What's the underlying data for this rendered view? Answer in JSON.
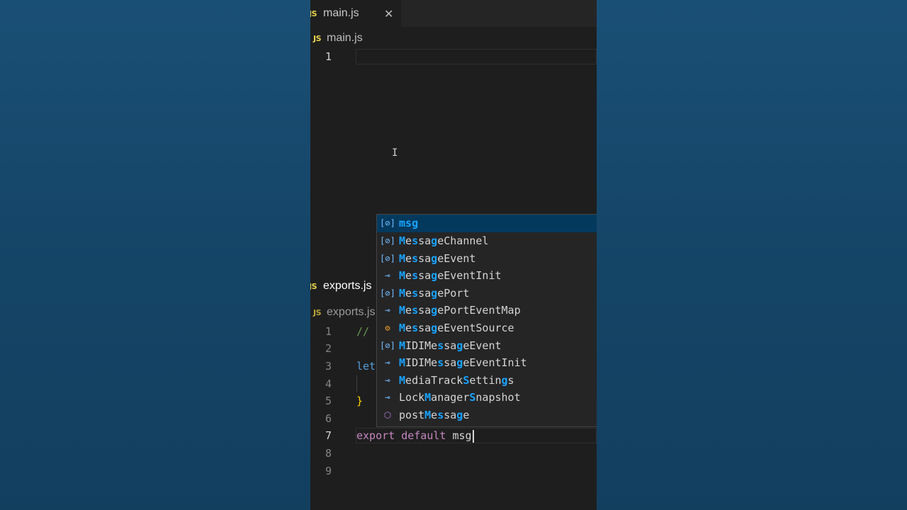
{
  "top_tab": {
    "badge": "JS",
    "label": "main.js",
    "close": "✕"
  },
  "top_breadcrumb": {
    "badge": "JS",
    "label": "main.js"
  },
  "top_lines": [
    {
      "n": "1"
    }
  ],
  "bottom_tab": {
    "badge": "JS",
    "label": "exports.js"
  },
  "bottom_breadcrumb": {
    "badge": "JS",
    "label": "exports.js"
  },
  "bottom_lines": [
    {
      "n": "1",
      "code": "//"
    },
    {
      "n": "2",
      "code": ""
    },
    {
      "n": "3",
      "code": "let"
    },
    {
      "n": "4",
      "code": ""
    },
    {
      "n": "5",
      "code": "}"
    },
    {
      "n": "6",
      "code": ""
    },
    {
      "n": "7",
      "kw": "export default",
      "ident": "msg"
    },
    {
      "n": "8",
      "code": ""
    },
    {
      "n": "9",
      "code": ""
    }
  ],
  "suggestions": [
    {
      "icon": "variable-icon",
      "glyph": "[⊘]",
      "label": "msg",
      "selected": true
    },
    {
      "icon": "variable-icon",
      "glyph": "[⊘]",
      "label": "MessageChannel"
    },
    {
      "icon": "variable-icon",
      "glyph": "[⊘]",
      "label": "MessageEvent"
    },
    {
      "icon": "interface-icon",
      "glyph": "⊸",
      "label": "MessageEventInit"
    },
    {
      "icon": "variable-icon",
      "glyph": "[⊘]",
      "label": "MessagePort"
    },
    {
      "icon": "interface-icon",
      "glyph": "⊸",
      "label": "MessagePortEventMap"
    },
    {
      "icon": "class-icon",
      "glyph": "⚙",
      "label": "MessageEventSource"
    },
    {
      "icon": "variable-icon",
      "glyph": "[⊘]",
      "label": "MIDIMessageEvent"
    },
    {
      "icon": "interface-icon",
      "glyph": "⊸",
      "label": "MIDIMessageEventInit"
    },
    {
      "icon": "interface-icon",
      "glyph": "⊸",
      "label": "MediaTrackSettings"
    },
    {
      "icon": "interface-icon",
      "glyph": "⊸",
      "label": "LockManagerSnapshot"
    },
    {
      "icon": "method-icon",
      "glyph": "⬡",
      "label": "postMessage"
    }
  ]
}
